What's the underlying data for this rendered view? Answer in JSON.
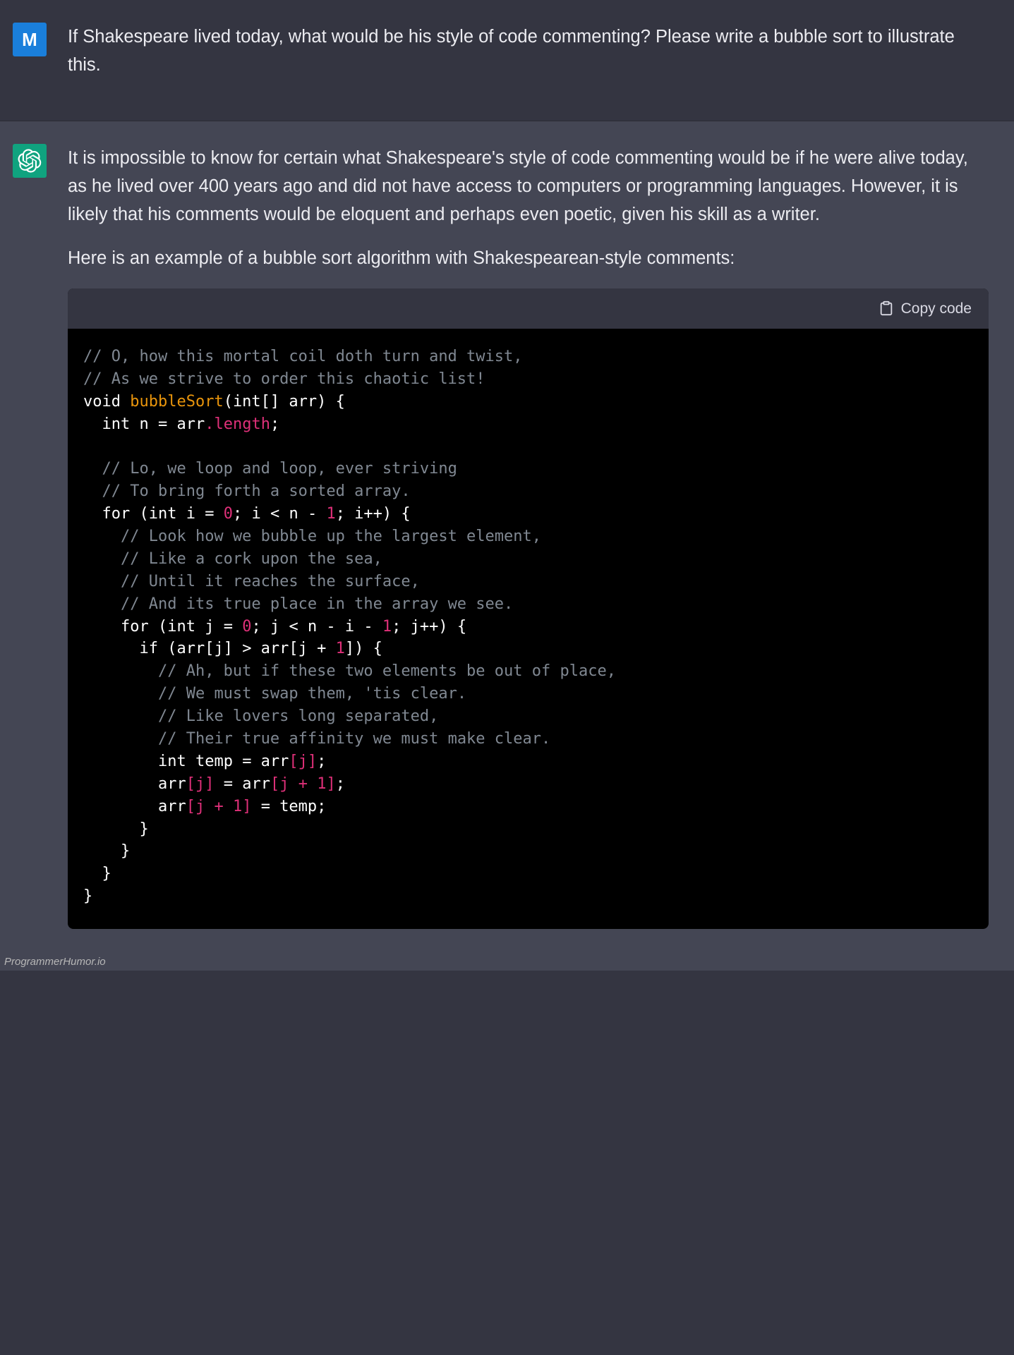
{
  "user": {
    "avatar_letter": "M",
    "message": "If Shakespeare lived today, what would be his style of code commenting? Please write a bubble sort to illustrate this."
  },
  "assistant": {
    "paragraph1": "It is impossible to know for certain what Shakespeare's style of code commenting would be if he were alive today, as he lived over 400 years ago and did not have access to computers or programming languages. However, it is likely that his comments would be eloquent and perhaps even poetic, given his skill as a writer.",
    "paragraph2": "Here is an example of a bubble sort algorithm with Shakespearean-style comments:",
    "copy_label": "Copy code",
    "code": {
      "c1a": "// O, how this mortal coil doth turn and twist,",
      "c1b": "// As we strive to order this chaotic list!",
      "kw_void": "void",
      "fn_name": "bubbleSort",
      "sig_open": "(",
      "sig_type": "int[] arr",
      "sig_close": ") {",
      "kw_int1": "int",
      "decl_n": " n = arr",
      "dot": ".",
      "prop_len": "length",
      "semi": ";",
      "c2a": "// Lo, we loop and loop, ever striving",
      "c2b": "// To bring forth a sorted array.",
      "kw_for1": "for",
      "for1_a": " (",
      "for1_int": "int",
      "for1_b": " i = ",
      "zero": "0",
      "for1_c": "; i < n - ",
      "one": "1",
      "for1_d": "; i++) {",
      "c3a": "// Look how we bubble up the largest element,",
      "c3b": "// Like a cork upon the sea,",
      "c3c": "// Until it reaches the surface,",
      "c3d": "// And its true place in the array we see.",
      "kw_for2": "for",
      "for2_a": " (",
      "for2_int": "int",
      "for2_b": " j = ",
      "for2_c": "; j < n - i - ",
      "for2_d": "; j++) {",
      "kw_if": "if",
      "if_a": " (arr[j] > arr[j + ",
      "if_b": "]) {",
      "c4a": "// Ah, but if these two elements be out of place,",
      "c4b": "// We must swap them, 'tis clear.",
      "c4c": "// Like lovers long separated,",
      "c4d": "// Their true affinity we must make clear.",
      "swap1_a": "int",
      "swap1_b": " temp = arr",
      "br_open": "[",
      "idx_j": "j",
      "br_close": "]",
      "swap2_a": "arr",
      "swap2_b": " = arr",
      "idx_j1_a": "[j + ",
      "idx_j1_b": "]",
      "swap3_a": "arr",
      "swap3_b": " = temp;",
      "close_brace": "}",
      "close2": "}",
      "close3": "}",
      "close4": "}"
    }
  },
  "watermark": "ProgrammerHumor.io"
}
